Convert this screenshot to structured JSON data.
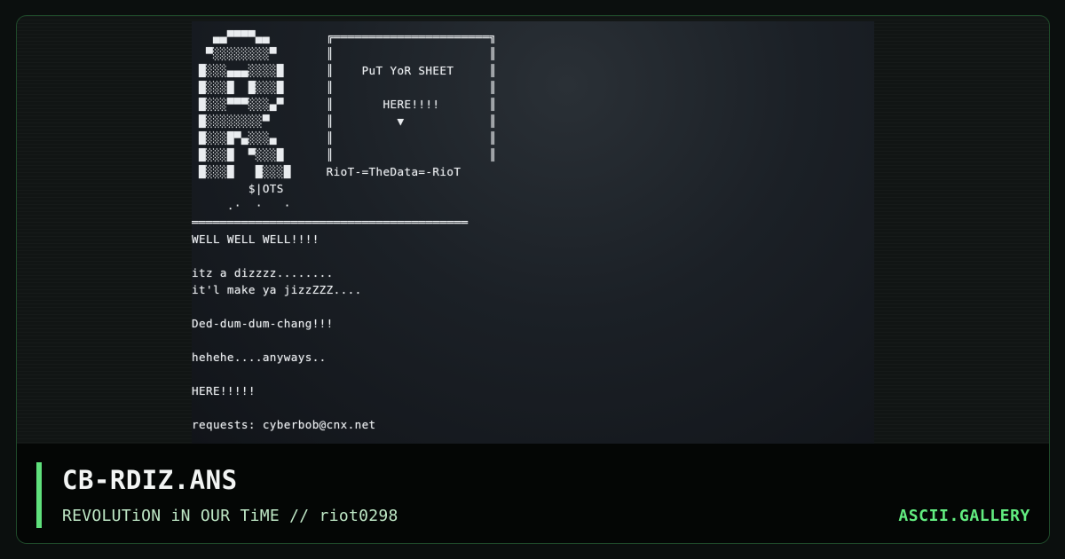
{
  "artwork": {
    "lines": [
      "   ▄▄▀▀▀▀▄▄        ╔══════════════════════╗",
      "  ▀░░░░░░░░▀       ║                      ║",
      " █░░░▄▄▄░░░░█      ║    PuT YoR SHEET     ║",
      " █░░░█  █░░░█      ║                      ║",
      " █░░░▀▀▀░░░▄▀      ║       HERE!!!!       ║",
      " █░░░░░░░░▀        ║         ▼            ║",
      " █░░░█▀▄░░░▄       ║                      ║",
      " █░░░█  ▀░░░█      ║                      ║",
      " █░░░█   █░░░█     RioT-=TheData=-RioT",
      "        $|OTS",
      "     .·  ·   ·",
      "═══════════════════════════════════════",
      "WELL WELL WELL!!!!",
      "",
      "itz a dizzzz........",
      "it'l make ya jizzZZZ....",
      "",
      "Ded-dum-dum-chang!!!",
      "",
      "hehehe....anyways..",
      "",
      "HERE!!!!!",
      "",
      "requests: cyberbob@cnx.net"
    ]
  },
  "caption": {
    "title": "CB-RDIZ.ANS",
    "subtitle": "REVOLUTiON iN OUR TiME // riot0298",
    "site": "ASCII.GALLERY"
  },
  "colors": {
    "accent": "#5fe07c",
    "site": "#62ec80",
    "subtitle": "#bfe8c6",
    "border": "#1f4a2a"
  }
}
